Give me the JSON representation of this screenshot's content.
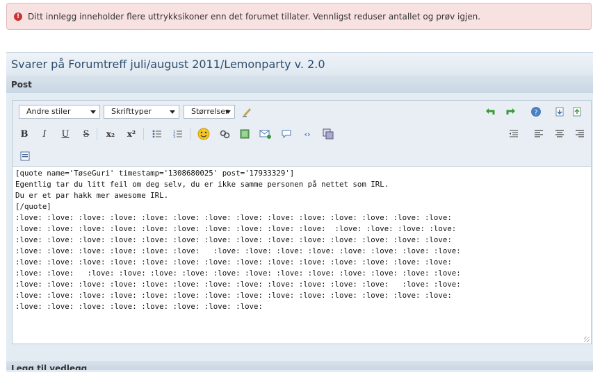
{
  "error": {
    "icon": "error-icon",
    "message": "Ditt innlegg inneholder flere uttrykksikoner enn det forumet tillater. Vennligst reduser antallet og prøv igjen."
  },
  "panel": {
    "title": "Svarer på Forumtreff juli/august 2011/Lemonparty v. 2.0",
    "subheader": "Post"
  },
  "toolbar": {
    "style_select": "Andre stiler",
    "font_select": "Skrifttyper",
    "size_select": "Størrelser",
    "icons": [
      "remove-format-icon",
      "undo-icon",
      "redo-icon",
      "help-icon",
      "download-icon",
      "upload-icon",
      "bold-icon",
      "italic-icon",
      "underline-icon",
      "strikethrough-icon",
      "subscript-icon",
      "superscript-icon",
      "bullet-list-icon",
      "numbered-list-icon",
      "smiley-icon",
      "link-icon",
      "image-icon",
      "email-icon",
      "quote-icon",
      "code-icon",
      "media-icon",
      "outdent-icon",
      "align-left-icon",
      "align-center-icon",
      "align-right-icon",
      "switch-mode-icon"
    ],
    "labels": {
      "bold": "B",
      "italic": "I",
      "underline": "U",
      "strike": "S",
      "sub": "x₂",
      "sup": "x²"
    }
  },
  "post_text": "[quote name='TøseGuri' timestamp='1308680025' post='17933329']\nEgentlig tar du litt feil om deg selv, du er ikke samme personen på nettet som IRL.\nDu er et par hakk mer awesome IRL.\n[/quote]\n:love: :love: :love: :love: :love: :love: :love: :love: :love: :love: :love: :love: :love: :love:\n:love: :love: :love: :love: :love: :love: :love: :love: :love: :love:  :love: :love: :love: :love:\n:love: :love: :love: :love: :love: :love: :love: :love: :love: :love: :love: :love: :love: :love:\n:love: :love: :love: :love: :love: :love:   :love: :love: :love: :love: :love: :love: :love: :love:\n:love: :love: :love: :love: :love: :love: :love: :love: :love: :love: :love: :love: :love: :love:\n:love: :love:   :love: :love: :love: :love: :love: :love: :love: :love: :love: :love: :love: :love:\n:love: :love: :love: :love: :love: :love: :love: :love: :love: :love: :love: :love:   :love: :love:\n:love: :love: :love: :love: :love: :love: :love: :love: :love: :love: :love: :love: :love: :love:\n:love: :love: :love: :love: :love: :love: :love: :love:",
  "bottom_header": "Legg til vedlegg"
}
